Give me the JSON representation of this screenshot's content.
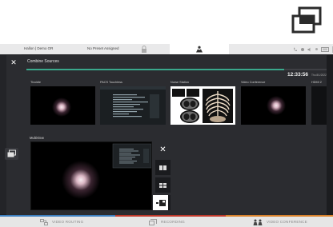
{
  "status_bar": {
    "title": "Hallon | Demo OR",
    "preset": "No Preset Assigned",
    "right_label": "888"
  },
  "panel": {
    "title": "Combine Sources",
    "clock": "12:33:56",
    "date": "Thu 8/1/2022"
  },
  "sources": [
    {
      "label": "Tivoidle"
    },
    {
      "label": "PACS Touchless"
    },
    {
      "label": "Nurse Station"
    },
    {
      "label": "Video Conference"
    },
    {
      "label": "HDMI 2"
    }
  ],
  "multiview": {
    "label": "MultiView"
  },
  "bottom_nav": [
    {
      "label": "VIDEO ROUTING"
    },
    {
      "label": "RECORDING"
    },
    {
      "label": "VIDEO CONFERENCE"
    }
  ],
  "colors": {
    "accent_teal": "#3aa88c",
    "accent_blue": "#3c7fc0",
    "accent_red": "#c0392b",
    "accent_orange": "#d9822b"
  }
}
